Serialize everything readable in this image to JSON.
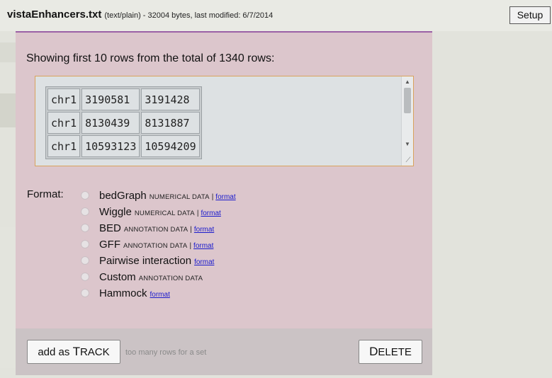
{
  "header": {
    "filename": "vistaEnhancers.txt",
    "meta": "(text/plain) - 32004 bytes, last modified: 6/7/2014",
    "setup_label": "Setup"
  },
  "dialog": {
    "heading": "Showing first 10 rows from the total of 1340 rows:",
    "preview_rows": [
      [
        "chr1",
        "3190581",
        "3191428"
      ],
      [
        "chr1",
        "8130439",
        "8131887"
      ],
      [
        "chr1",
        "10593123",
        "10594209"
      ]
    ],
    "format_label": "Format:",
    "formats": [
      {
        "name": "bedGraph",
        "kind": "numerical data",
        "sep": "|",
        "link": "format"
      },
      {
        "name": "Wiggle",
        "kind": "numerical data",
        "sep": "|",
        "link": "format"
      },
      {
        "name": "BED",
        "kind": "annotation data",
        "sep": "|",
        "link": "format"
      },
      {
        "name": "GFF",
        "kind": "annotation data",
        "sep": "|",
        "link": "format"
      },
      {
        "name": "Pairwise interaction",
        "kind": "",
        "sep": "",
        "link": "format"
      },
      {
        "name": "Custom",
        "kind": "annotation data",
        "sep": "",
        "link": ""
      },
      {
        "name": "Hammock",
        "kind": "",
        "sep": "",
        "link": "format"
      }
    ],
    "add_track_prefix": "add as ",
    "add_track_big": "T",
    "add_track_rest": "RACK",
    "hint": "too many rows for a set",
    "delete_big": "D",
    "delete_rest": "ELETE"
  },
  "colors": {
    "panel_bg": "#dcc6cc",
    "accent_line": "#9b60a6",
    "link": "#1a1acc",
    "preview_border": "#d9a25c"
  },
  "icons": {
    "scroll_up": "▲",
    "scroll_down": "▼",
    "resize_grip": "⟋"
  }
}
